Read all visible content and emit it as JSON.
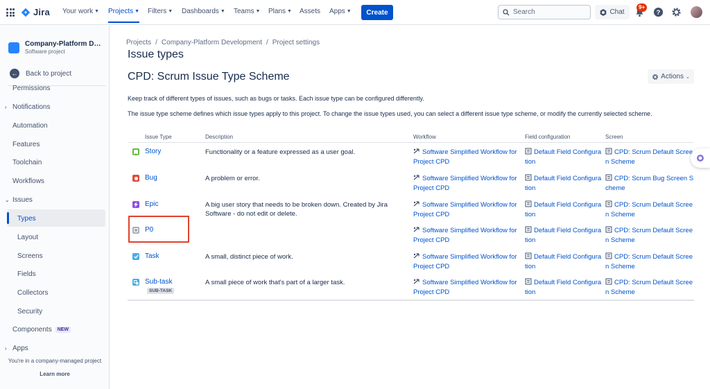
{
  "topnav": {
    "logo_text": "Jira",
    "items": [
      {
        "label": "Your work"
      },
      {
        "label": "Projects"
      },
      {
        "label": "Filters"
      },
      {
        "label": "Dashboards"
      },
      {
        "label": "Teams"
      },
      {
        "label": "Plans"
      },
      {
        "label": "Assets"
      },
      {
        "label": "Apps"
      }
    ],
    "create_label": "Create",
    "search_placeholder": "Search",
    "chat_label": "Chat",
    "notification_badge": "9+"
  },
  "sidebar": {
    "project_name": "Company-Platform Development",
    "project_type": "Software project",
    "back_label": "Back to project",
    "items": [
      {
        "label": "Permissions"
      },
      {
        "label": "Notifications"
      },
      {
        "label": "Automation"
      },
      {
        "label": "Features"
      },
      {
        "label": "Toolchain"
      },
      {
        "label": "Workflows"
      },
      {
        "label": "Issues"
      },
      {
        "label": "Types"
      },
      {
        "label": "Layout"
      },
      {
        "label": "Screens"
      },
      {
        "label": "Fields"
      },
      {
        "label": "Collectors"
      },
      {
        "label": "Security"
      },
      {
        "label": "Components"
      },
      {
        "label": "Apps"
      }
    ],
    "new_badge": "NEW",
    "footer_text": "You're in a company-managed project",
    "learn_more": "Learn more"
  },
  "breadcrumb": [
    "Projects",
    "/",
    "Company-Platform Development",
    "/",
    "Project settings"
  ],
  "page_title": "Issue types",
  "scheme_title": "CPD: Scrum Issue Type Scheme",
  "actions_label": "Actions",
  "description_1": "Keep track of different types of issues, such as bugs or tasks. Each issue type can be configured differently.",
  "description_2": "The issue type scheme defines which issue types apply to this project. To change the issue types used, you can select a different issue type scheme, or modify the currently selected scheme.",
  "table": {
    "headers": [
      "Issue Type",
      "Description",
      "Workflow",
      "Field configuration",
      "Screen"
    ],
    "rows": [
      {
        "name": "Story",
        "description": "Functionality or a feature expressed as a user goal.",
        "workflow": "Software Simplified Workflow for Project CPD",
        "field_config": "Default Field Configuration",
        "screen": "CPD: Scrum Default Screen Scheme",
        "icon": "story-icon",
        "color": "#63ba3c"
      },
      {
        "name": "Bug",
        "description": "A problem or error.",
        "workflow": "Software Simplified Workflow for Project CPD",
        "field_config": "Default Field Configuration",
        "screen": "CPD: Scrum Bug Screen Scheme",
        "icon": "bug-icon",
        "color": "#e5493a"
      },
      {
        "name": "Epic",
        "description": "A big user story that needs to be broken down. Created by Jira Software - do not edit or delete.",
        "workflow": "Software Simplified Workflow for Project CPD",
        "field_config": "Default Field Configuration",
        "screen": "CPD: Scrum Default Screen Scheme",
        "icon": "epic-icon",
        "color": "#904ee2"
      },
      {
        "name": "P0",
        "description": "",
        "workflow": "Software Simplified Workflow for Project CPD",
        "field_config": "Default Field Configuration",
        "screen": "CPD: Scrum Default Screen Scheme",
        "icon": "generic-issue-icon",
        "color": "#a5adba"
      },
      {
        "name": "Task",
        "description": "A small, distinct piece of work.",
        "workflow": "Software Simplified Workflow for Project CPD",
        "field_config": "Default Field Configuration",
        "screen": "CPD: Scrum Default Screen Scheme",
        "icon": "task-icon",
        "color": "#4bade8"
      },
      {
        "name": "Sub-task",
        "description": "A small piece of work that's part of a larger task.",
        "workflow": "Software Simplified Workflow for Project CPD",
        "field_config": "Default Field Configuration",
        "screen": "CPD: Scrum Default Screen Scheme",
        "icon": "subtask-icon",
        "color": "#4bade8",
        "lozenge": "SUB-TASK"
      }
    ]
  },
  "colors": {
    "accent": "#0052cc",
    "highlight": "#e0412e"
  }
}
